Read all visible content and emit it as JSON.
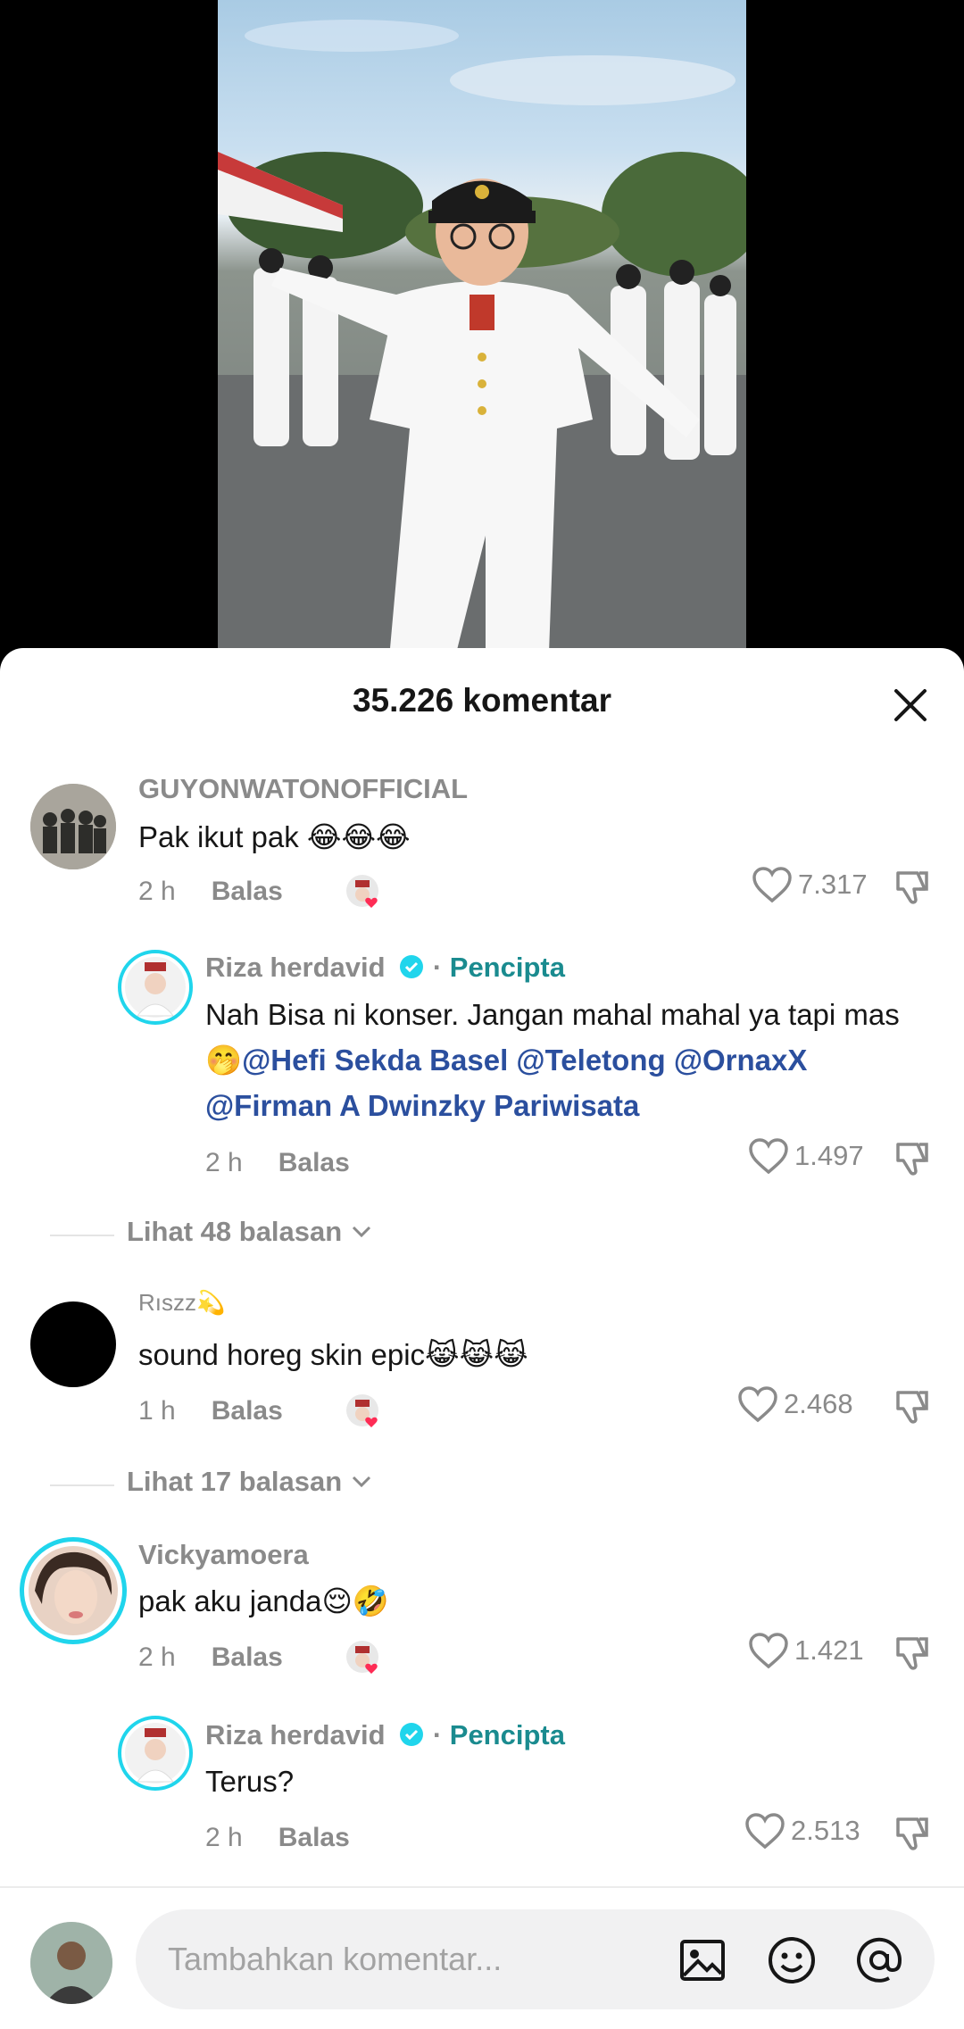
{
  "sheet": {
    "title": "35.226 komentar"
  },
  "comments": [
    {
      "username": "GUYONWATONOFFICIAL",
      "text": "Pak ikut pak 😂😂😂",
      "time": "2 h",
      "reply_label": "Balas",
      "likes": "7.317",
      "creator_liked": true
    },
    {
      "username": "Riza herdavid",
      "badge": "Pencipta",
      "text_plain": "Nah Bisa ni konser. Jangan mahal mahal ya tapi mas🤭",
      "mentions": [
        "@Hefi Sekda Basel",
        "@Teletong",
        "@OrnaxX",
        "@Firman A Dwinzky Pariwisata"
      ],
      "time": "2 h",
      "reply_label": "Balas",
      "likes": "1.497"
    },
    {
      "view_replies": "Lihat 48 balasan"
    },
    {
      "username": "Rıszz💫",
      "text": "sound horeg skin epic😹😹😹",
      "time": "1 h",
      "reply_label": "Balas",
      "likes": "2.468",
      "creator_liked": true
    },
    {
      "view_replies": "Lihat 17 balasan"
    },
    {
      "username": "Vickyamoera",
      "text": "pak aku janda😌🤣",
      "time": "2 h",
      "reply_label": "Balas",
      "likes": "1.421",
      "creator_liked": true
    },
    {
      "username": "Riza herdavid",
      "badge": "Pencipta",
      "text": "Terus?",
      "time": "2 h",
      "reply_label": "Balas",
      "likes": "2.513"
    }
  ],
  "composer": {
    "placeholder": "Tambahkan komentar..."
  },
  "colors": {
    "creator_badge": "#1a8b8f",
    "mention": "#2b4f9e",
    "verified": "#20d5ec",
    "like_heart": "#fe2c55"
  },
  "icons": [
    "close-icon",
    "heart-icon",
    "dislike-icon",
    "verified-icon",
    "image-icon",
    "emoji-icon",
    "at-icon",
    "chevron-down-icon"
  ]
}
